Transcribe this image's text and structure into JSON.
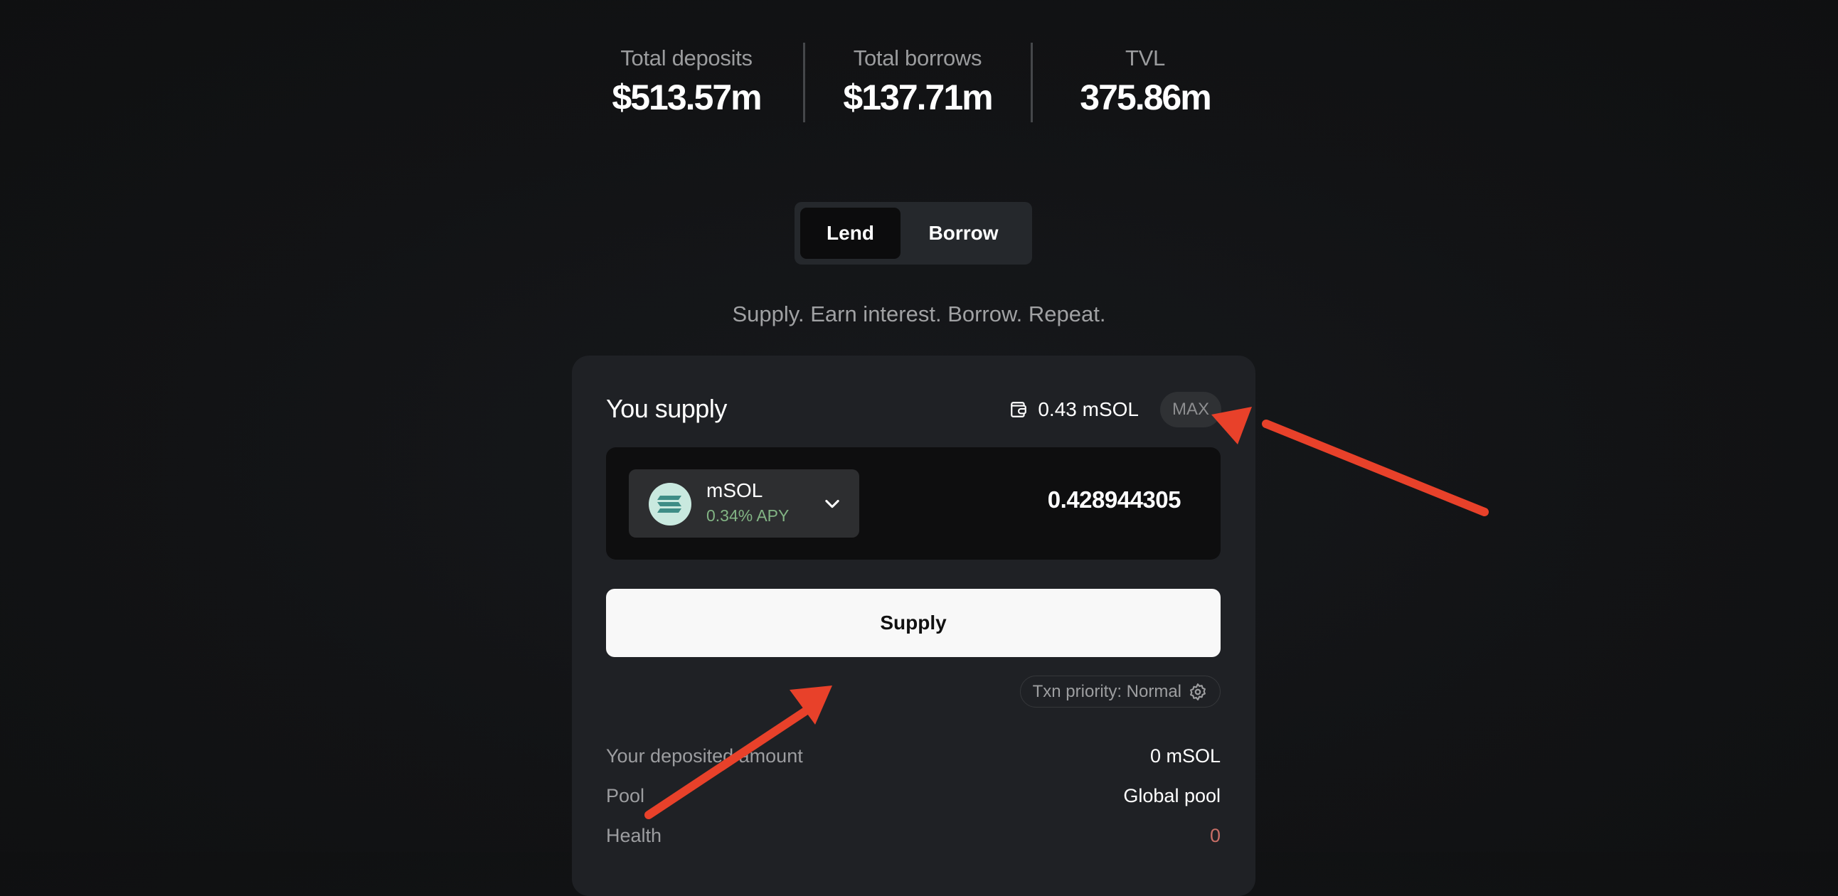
{
  "stats": [
    {
      "label": "Total deposits",
      "value": "$513.57m"
    },
    {
      "label": "Total borrows",
      "value": "$137.71m"
    },
    {
      "label": "TVL",
      "value": "375.86m"
    }
  ],
  "mode_toggle": {
    "options": [
      "Lend",
      "Borrow"
    ],
    "selected": "Lend"
  },
  "tagline": "Supply. Earn interest. Borrow. Repeat.",
  "card": {
    "title": "You supply",
    "wallet_balance": "0.43 mSOL",
    "max_label": "MAX",
    "token": {
      "symbol": "mSOL",
      "apy": "0.34% APY",
      "icon": "msol-logo-icon"
    },
    "amount": "0.428944305",
    "action_label": "Supply",
    "priority_label": "Txn priority: Normal",
    "details": [
      {
        "label": "Your deposited amount",
        "value": "0 mSOL"
      },
      {
        "label": "Pool",
        "value": "Global pool"
      },
      {
        "label": "Health",
        "value": "0"
      }
    ]
  },
  "colors": {
    "accent_apy": "#82b484",
    "health_danger": "#c76e66",
    "annotation_arrow": "#e8412a"
  }
}
